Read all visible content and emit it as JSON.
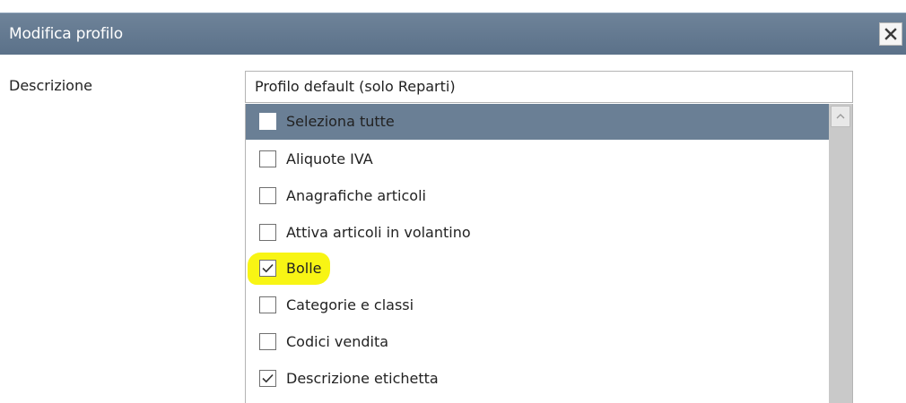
{
  "dialog": {
    "title": "Modifica profilo",
    "close_icon": "close-icon"
  },
  "form": {
    "description_label": "Descrizione",
    "description_value": "Profilo default  (solo Reparti)"
  },
  "list": {
    "items": [
      {
        "label": "Seleziona tutte",
        "checked": false,
        "selected": true
      },
      {
        "label": "Aliquote IVA",
        "checked": false
      },
      {
        "label": "Anagrafiche articoli",
        "checked": false
      },
      {
        "label": "Attiva articoli in volantino",
        "checked": false
      },
      {
        "label": "Bolle",
        "checked": true,
        "highlighted": true
      },
      {
        "label": "Categorie e classi",
        "checked": false
      },
      {
        "label": "Codici vendita",
        "checked": false
      },
      {
        "label": "Descrizione etichetta",
        "checked": true
      }
    ]
  },
  "colors": {
    "title_bar": "#5b7189",
    "selection": "#6a7f95",
    "highlight": "#f7f400"
  }
}
